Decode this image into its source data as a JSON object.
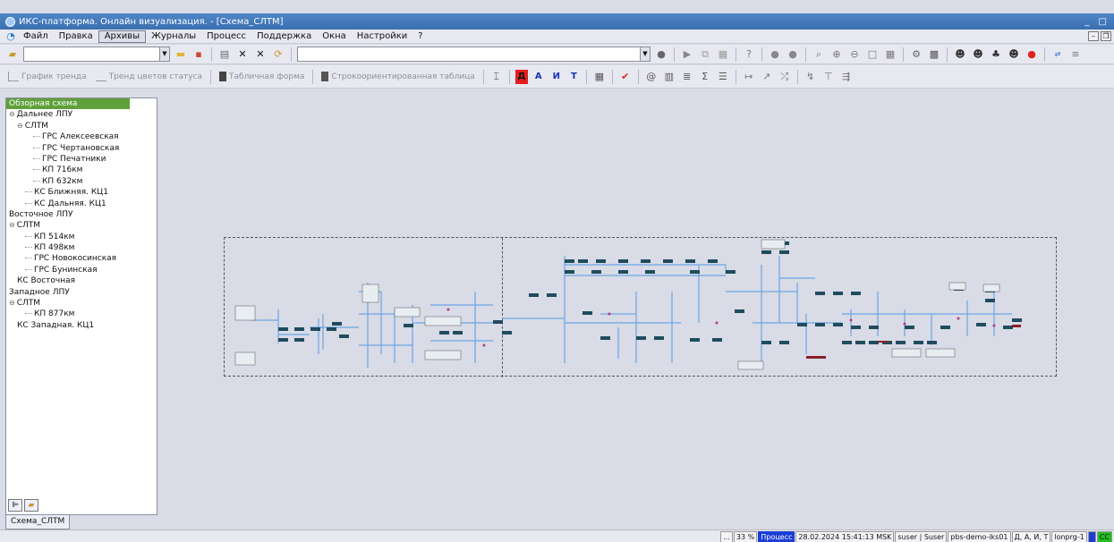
{
  "window": {
    "title": "ИКС-платформа. Онлайн визуализация. - [Схема_СЛТМ]"
  },
  "menu": {
    "items": [
      "Файл",
      "Правка",
      "Архивы",
      "Журналы",
      "Процесс",
      "Поддержка",
      "Окна",
      "Настройки",
      "?"
    ],
    "active_index": 2
  },
  "toolbar2": {
    "trend_chart": "График тренда",
    "status_color_trend": "Тренд цветов статуса",
    "table_form": "Табличная форма",
    "row_table": "Строкоориентированная таблица",
    "letter_d": "Д",
    "letter_a": "А",
    "letter_i": "И",
    "letter_t": "Т"
  },
  "tree": {
    "items": [
      {
        "label": "Обзорная схема",
        "level": 0,
        "selected": true
      },
      {
        "label": "Дальнее ЛПУ",
        "level": 0,
        "expander": "⊖"
      },
      {
        "label": "СЛТМ",
        "level": 1,
        "expander": "⊖"
      },
      {
        "label": "ГРС Алексеевская",
        "level": 3
      },
      {
        "label": "ГРС Чертановская",
        "level": 3
      },
      {
        "label": "ГРС Печатники",
        "level": 3
      },
      {
        "label": "КП 716км",
        "level": 3
      },
      {
        "label": "КП 632км",
        "level": 3
      },
      {
        "label": "КС Ближняя. КЦ1",
        "level": 2
      },
      {
        "label": "КС Дальняя. КЦ1",
        "level": 2
      },
      {
        "label": "Восточное ЛПУ",
        "level": 0
      },
      {
        "label": "СЛТМ",
        "level": 0,
        "expander": "⊖"
      },
      {
        "label": "КП 514км",
        "level": 2
      },
      {
        "label": "КП 498км",
        "level": 2
      },
      {
        "label": "ГРС Новокосинская",
        "level": 2
      },
      {
        "label": "ГРС Бунинская",
        "level": 2
      },
      {
        "label": "КС Восточная",
        "level": 1
      },
      {
        "label": "Западное ЛПУ",
        "level": 0
      },
      {
        "label": "СЛТМ",
        "level": 0,
        "expander": "⊖"
      },
      {
        "label": "КП 877км",
        "level": 2
      },
      {
        "label": "КС Западная. КЦ1",
        "level": 1
      }
    ]
  },
  "document_tab": "Схема_СЛТМ",
  "status": {
    "dots": "...",
    "zoom": "33 %",
    "mode": "Процесс",
    "datetime": "28.02.2024 15:41:13 MSK",
    "user": "suser | Suser",
    "host": "pbs-demo-iks01",
    "flags": "Д, А, И, Т",
    "node": "lonprg-1",
    "cc": "CC"
  },
  "colors": {
    "titlebar": "#3a6fb0",
    "selected_tree": "#5fa03a",
    "pipe": "#6aa6e6",
    "station_block": "#1f4c5e",
    "status_highlight": "#1b3fd6"
  }
}
